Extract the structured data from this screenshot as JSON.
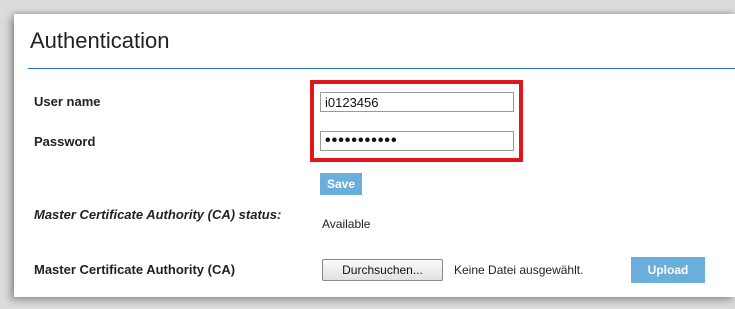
{
  "section": {
    "title": "Authentication"
  },
  "form": {
    "username_label": "User name",
    "username_value": "i0123456",
    "password_label": "Password",
    "password_value": "•••••••••••",
    "save_label": "Save",
    "ca_status_label": "Master Certificate Authority (CA) status:",
    "ca_status_value": "Available",
    "ca_label": "Master Certificate Authority (CA)",
    "browse_label": "Durchsuchen...",
    "file_status": "Keine Datei ausgewählt.",
    "upload_label": "Upload"
  },
  "colors": {
    "accent": "#1f73c5",
    "button": "#6aaedc",
    "highlight": "#e0151d"
  }
}
